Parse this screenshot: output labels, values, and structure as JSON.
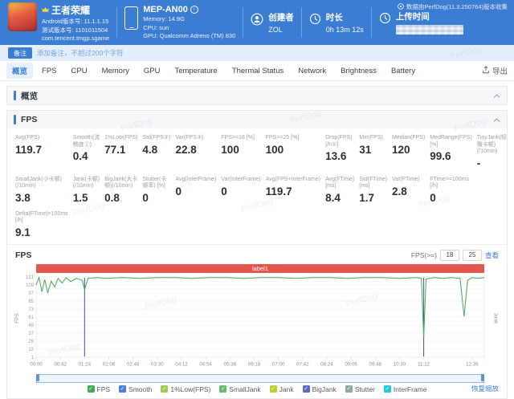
{
  "header": {
    "app": {
      "title": "王者荣耀",
      "version_line": "Android版本号: 11.1.1.15",
      "build_line": "测试版本号: 1101011504",
      "package": "com.tencent.tmgp.sgame"
    },
    "device": {
      "name": "MEP-AN00",
      "memory": "Memory: 14.9G",
      "cpu": "CPU: sun",
      "gpu": "GPU: Qualcomm Adreno (TM) 830"
    },
    "creator": {
      "label": "创建者",
      "value": "ZOL"
    },
    "duration": {
      "label": "时长",
      "value": "0h 13m 12s"
    },
    "upload": {
      "label": "上传时间"
    },
    "collector_note": "数据由PerfDog(11.3.250764)版本收集"
  },
  "note_bar": {
    "button": "备注",
    "text": "添加备注，不超过200个字符"
  },
  "tabs": [
    "概览",
    "FPS",
    "CPU",
    "Memory",
    "GPU",
    "Temperature",
    "Thermal Status",
    "Network",
    "Brightness",
    "Battery"
  ],
  "active_tab": "概览",
  "export_label": "导出",
  "sections": {
    "overview": "概览",
    "fps": "FPS"
  },
  "metrics": {
    "row1": [
      {
        "label": "Avg(FPS)",
        "value": "119.7"
      },
      {
        "label": "Smooth(流畅度②)",
        "value": "0.4"
      },
      {
        "label": "1%Low(FPS)",
        "value": "77.1"
      },
      {
        "label": "Std(FPS②)",
        "value": "4.8"
      },
      {
        "label": "Var(FPS③)",
        "value": "22.8"
      },
      {
        "label": "FPS>=18 [%]",
        "value": "100"
      },
      {
        "label": "FPS>=25 [%]",
        "value": "100"
      },
      {
        "label": "Drop(FPS) [/h①]",
        "value": "13.6"
      },
      {
        "label": "Min(FPS)",
        "value": "31"
      },
      {
        "label": "Median(FPS)",
        "value": "120"
      },
      {
        "label": "MedRange(FPS)[%]",
        "value": "99.6"
      },
      {
        "label": "TinyJank(轻微卡顿)(/10min)",
        "value": "-"
      }
    ],
    "row2": [
      {
        "label": "SmallJank(小卡顿)(/10min)",
        "value": "3.8"
      },
      {
        "label": "Jank(卡顿)(/10min)",
        "value": "1.5"
      },
      {
        "label": "BigJank(大卡顿)(/10min)",
        "value": "0.8"
      },
      {
        "label": "Stutter(卡顿率) [%]",
        "value": "0"
      },
      {
        "label": "Avg(InterFrame)",
        "value": "0"
      },
      {
        "label": "Var(InterFrame)",
        "value": "0"
      },
      {
        "label": "Avg(FPS+InterFrame)",
        "value": "119.7"
      },
      {
        "label": "Avg(FTime) [ms]",
        "value": "8.4"
      },
      {
        "label": "Std(FTime) [ms]",
        "value": "1.7"
      },
      {
        "label": "Var(FTime)",
        "value": "2.8"
      },
      {
        "label": "FTime>=100ms [/h]",
        "value": "0"
      }
    ],
    "row3": [
      {
        "label": "Delta(FTime)>100ms [/h]",
        "value": "9.1"
      }
    ]
  },
  "chart_controls": {
    "title": "FPS",
    "threshold_label": "FPS(>=)",
    "low_value": "18",
    "high_value": "25",
    "view_link": "查看",
    "band_label": "label1",
    "reset_label": "恢复缩放"
  },
  "chart_data": {
    "type": "line",
    "title": "FPS",
    "ylabel_left": "FPS",
    "ylabel_right": "Jank",
    "ylim": [
      1,
      121
    ],
    "y_ticks": [
      121,
      109,
      97,
      85,
      73,
      61,
      49,
      37,
      25,
      13,
      1
    ],
    "x_max_seconds": 777,
    "x_ticks": [
      "00:00",
      "00:42",
      "01:24",
      "02:06",
      "02:48",
      "03:30",
      "04:12",
      "04:54",
      "05:36",
      "06:18",
      "07:00",
      "07:42",
      "08:24",
      "09:06",
      "09:48",
      "10:30",
      "11:12",
      "12:36"
    ],
    "grid": true,
    "legend_position": "bottom",
    "series": [
      {
        "name": "FPS",
        "color": "#45a854",
        "points": [
          [
            0,
            109
          ],
          [
            5,
            120
          ],
          [
            10,
            99
          ],
          [
            15,
            117
          ],
          [
            20,
            97
          ],
          [
            26,
            115
          ],
          [
            32,
            106
          ],
          [
            38,
            119
          ],
          [
            45,
            112
          ],
          [
            52,
            120
          ],
          [
            60,
            114
          ],
          [
            70,
            119
          ],
          [
            80,
            116
          ],
          [
            84,
            102
          ],
          [
            90,
            119
          ],
          [
            105,
            120
          ],
          [
            120,
            119
          ],
          [
            150,
            120
          ],
          [
            180,
            119
          ],
          [
            210,
            120
          ],
          [
            240,
            120
          ],
          [
            270,
            119
          ],
          [
            300,
            120
          ],
          [
            330,
            120
          ],
          [
            360,
            119
          ],
          [
            390,
            120
          ],
          [
            420,
            120
          ],
          [
            450,
            119
          ],
          [
            480,
            120
          ],
          [
            510,
            120
          ],
          [
            540,
            119
          ],
          [
            570,
            120
          ],
          [
            600,
            120
          ],
          [
            630,
            119
          ],
          [
            660,
            120
          ],
          [
            668,
            119
          ],
          [
            672,
            31
          ],
          [
            676,
            118
          ],
          [
            690,
            120
          ],
          [
            705,
            119
          ],
          [
            720,
            120
          ],
          [
            735,
            119
          ],
          [
            742,
            62
          ],
          [
            748,
            116
          ],
          [
            756,
            120
          ],
          [
            766,
            119
          ],
          [
            777,
            120
          ]
        ]
      }
    ],
    "jank_events_x": [
      84,
      672
    ]
  },
  "legend": [
    {
      "label": "FPS",
      "color": "#45a854"
    },
    {
      "label": "Smooth",
      "color": "#4a7fd8"
    },
    {
      "label": "1%Low(FPS)",
      "color": "#9acd5a"
    },
    {
      "label": "SmallJank",
      "color": "#66bb6a"
    },
    {
      "label": "Jank",
      "color": "#c0ca33"
    },
    {
      "label": "BigJank",
      "color": "#5c6bc0"
    },
    {
      "label": "Stutter",
      "color": "#90a4ae"
    },
    {
      "label": "InterFrame",
      "color": "#26c6da"
    }
  ],
  "check_glyph": "✓",
  "watermark": "PerfDog"
}
